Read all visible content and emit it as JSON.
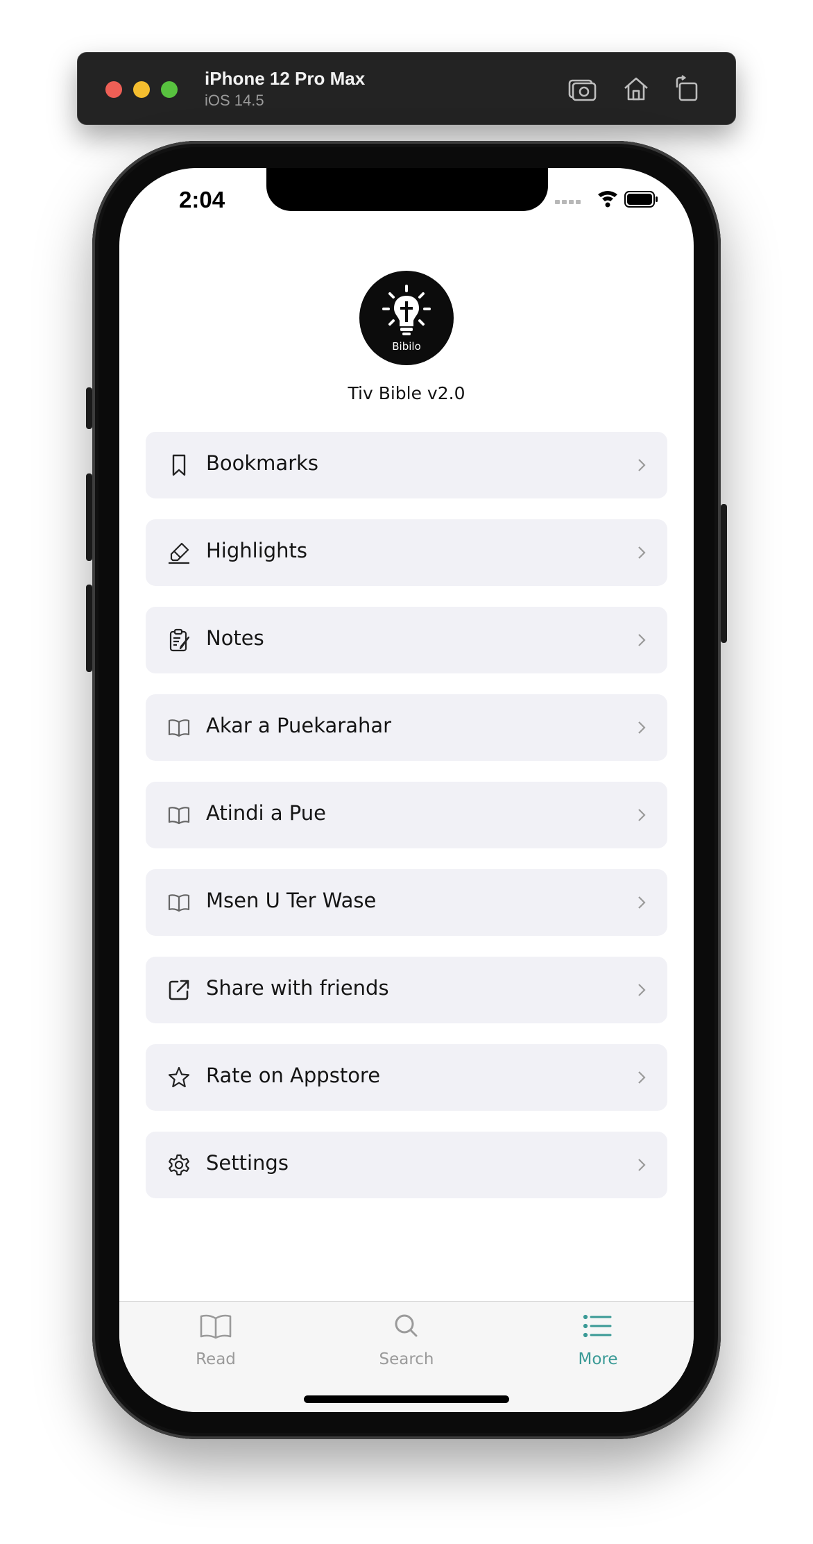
{
  "simulator": {
    "device_name": "iPhone 12 Pro Max",
    "os_version": "iOS 14.5"
  },
  "status_bar": {
    "time": "2:04"
  },
  "app": {
    "logo_text": "Bibilo",
    "version_label": "Tiv Bible v2.0"
  },
  "menu": {
    "items": [
      {
        "label": "Bookmarks",
        "icon": "bookmark-icon"
      },
      {
        "label": "Highlights",
        "icon": "highlighter-icon"
      },
      {
        "label": "Notes",
        "icon": "clipboard-icon"
      },
      {
        "label": "Akar a Puekarahar",
        "icon": "book-icon"
      },
      {
        "label": "Atindi a Pue",
        "icon": "book-icon"
      },
      {
        "label": "Msen U Ter Wase",
        "icon": "book-icon"
      },
      {
        "label": "Share with friends",
        "icon": "share-icon"
      },
      {
        "label": "Rate on Appstore",
        "icon": "star-icon"
      },
      {
        "label": "Settings",
        "icon": "gear-icon"
      }
    ]
  },
  "tabbar": {
    "tabs": [
      {
        "label": "Read",
        "icon": "book-icon",
        "active": false
      },
      {
        "label": "Search",
        "icon": "search-icon",
        "active": false
      },
      {
        "label": "More",
        "icon": "list-icon",
        "active": true
      }
    ],
    "active_color": "#3a9a96",
    "inactive_color": "#9a9a9a"
  }
}
